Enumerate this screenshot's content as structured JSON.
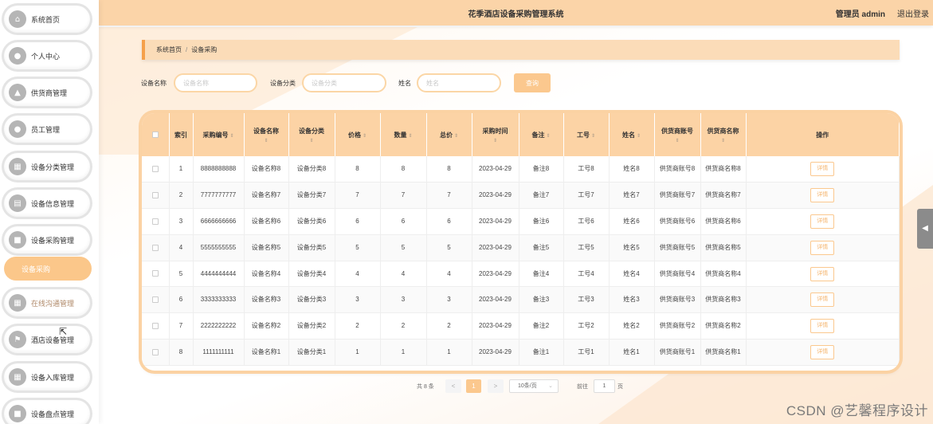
{
  "header": {
    "title": "花季酒店设备采购管理系统",
    "user": "管理员 admin",
    "logout": "退出登录"
  },
  "sidebar": {
    "items": [
      {
        "label": "系统首页",
        "icon": "home-icon",
        "glyph": "⌂"
      },
      {
        "label": "个人中心",
        "icon": "person-icon",
        "glyph": "●"
      },
      {
        "label": "供货商管理",
        "icon": "thumb-icon",
        "glyph": "▲"
      },
      {
        "label": "员工管理",
        "icon": "person-icon",
        "glyph": "●"
      },
      {
        "label": "设备分类管理",
        "icon": "grid-icon",
        "glyph": "▦"
      },
      {
        "label": "设备信息管理",
        "icon": "document-icon",
        "glyph": "▤"
      },
      {
        "label": "设备采购管理",
        "icon": "chat-icon",
        "glyph": "■"
      },
      {
        "label": "在线沟通管理",
        "icon": "grid-icon",
        "glyph": "▦"
      },
      {
        "label": "酒店设备管理",
        "icon": "flag-icon",
        "glyph": "⚑"
      },
      {
        "label": "设备入库管理",
        "icon": "grid-icon",
        "glyph": "▦"
      },
      {
        "label": "设备盘点管理",
        "icon": "chat-icon",
        "glyph": "■"
      }
    ],
    "active_sub": "设备采购"
  },
  "breadcrumb": {
    "home": "系统首页",
    "separator": "/",
    "current": "设备采购"
  },
  "search": {
    "fields": [
      {
        "label": "设备名称",
        "placeholder": "设备名称"
      },
      {
        "label": "设备分类",
        "placeholder": "设备分类"
      },
      {
        "label": "姓名",
        "placeholder": "姓名"
      }
    ],
    "button": "查询"
  },
  "table": {
    "columns": [
      "索引",
      "采购编号",
      "设备名称",
      "设备分类",
      "价格",
      "数量",
      "总价",
      "采购时间",
      "备注",
      "工号",
      "姓名",
      "供货商账号",
      "供货商名称",
      "操作"
    ],
    "rows": [
      {
        "index": "1",
        "purchase_no": "8888888888",
        "device_name": "设备名称8",
        "category": "设备分类8",
        "price": "8",
        "qty": "8",
        "total": "8",
        "time": "2023-04-29",
        "remark": "备注8",
        "emp_no": "工号8",
        "name": "姓名8",
        "supplier_acc": "供货商账号8",
        "supplier_name": "供货商名称8",
        "action": "详情"
      },
      {
        "index": "2",
        "purchase_no": "7777777777",
        "device_name": "设备名称7",
        "category": "设备分类7",
        "price": "7",
        "qty": "7",
        "total": "7",
        "time": "2023-04-29",
        "remark": "备注7",
        "emp_no": "工号7",
        "name": "姓名7",
        "supplier_acc": "供货商账号7",
        "supplier_name": "供货商名称7",
        "action": "详情"
      },
      {
        "index": "3",
        "purchase_no": "6666666666",
        "device_name": "设备名称6",
        "category": "设备分类6",
        "price": "6",
        "qty": "6",
        "total": "6",
        "time": "2023-04-29",
        "remark": "备注6",
        "emp_no": "工号6",
        "name": "姓名6",
        "supplier_acc": "供货商账号6",
        "supplier_name": "供货商名称6",
        "action": "详情"
      },
      {
        "index": "4",
        "purchase_no": "5555555555",
        "device_name": "设备名称5",
        "category": "设备分类5",
        "price": "5",
        "qty": "5",
        "total": "5",
        "time": "2023-04-29",
        "remark": "备注5",
        "emp_no": "工号5",
        "name": "姓名5",
        "supplier_acc": "供货商账号5",
        "supplier_name": "供货商名称5",
        "action": "详情"
      },
      {
        "index": "5",
        "purchase_no": "4444444444",
        "device_name": "设备名称4",
        "category": "设备分类4",
        "price": "4",
        "qty": "4",
        "total": "4",
        "time": "2023-04-29",
        "remark": "备注4",
        "emp_no": "工号4",
        "name": "姓名4",
        "supplier_acc": "供货商账号4",
        "supplier_name": "供货商名称4",
        "action": "详情"
      },
      {
        "index": "6",
        "purchase_no": "3333333333",
        "device_name": "设备名称3",
        "category": "设备分类3",
        "price": "3",
        "qty": "3",
        "total": "3",
        "time": "2023-04-29",
        "remark": "备注3",
        "emp_no": "工号3",
        "name": "姓名3",
        "supplier_acc": "供货商账号3",
        "supplier_name": "供货商名称3",
        "action": "详情"
      },
      {
        "index": "7",
        "purchase_no": "2222222222",
        "device_name": "设备名称2",
        "category": "设备分类2",
        "price": "2",
        "qty": "2",
        "total": "2",
        "time": "2023-04-29",
        "remark": "备注2",
        "emp_no": "工号2",
        "name": "姓名2",
        "supplier_acc": "供货商账号2",
        "supplier_name": "供货商名称2",
        "action": "详情"
      },
      {
        "index": "8",
        "purchase_no": "1111111111",
        "device_name": "设备名称1",
        "category": "设备分类1",
        "price": "1",
        "qty": "1",
        "total": "1",
        "time": "2023-04-29",
        "remark": "备注1",
        "emp_no": "工号1",
        "name": "姓名1",
        "supplier_acc": "供货商账号1",
        "supplier_name": "供货商名称1",
        "action": "详情"
      }
    ]
  },
  "pagination": {
    "total": "共 8 条",
    "prev": "<",
    "current_page": "1",
    "next": ">",
    "page_size": "10条/页",
    "goto_label": "前往",
    "goto_value": "1",
    "page_suffix": "页"
  },
  "watermark": "CSDN @艺馨程序设计",
  "colors": {
    "accent": "#fbc88e",
    "header_bg": "#fbd4a8",
    "table_header": "#fcd3a5"
  }
}
